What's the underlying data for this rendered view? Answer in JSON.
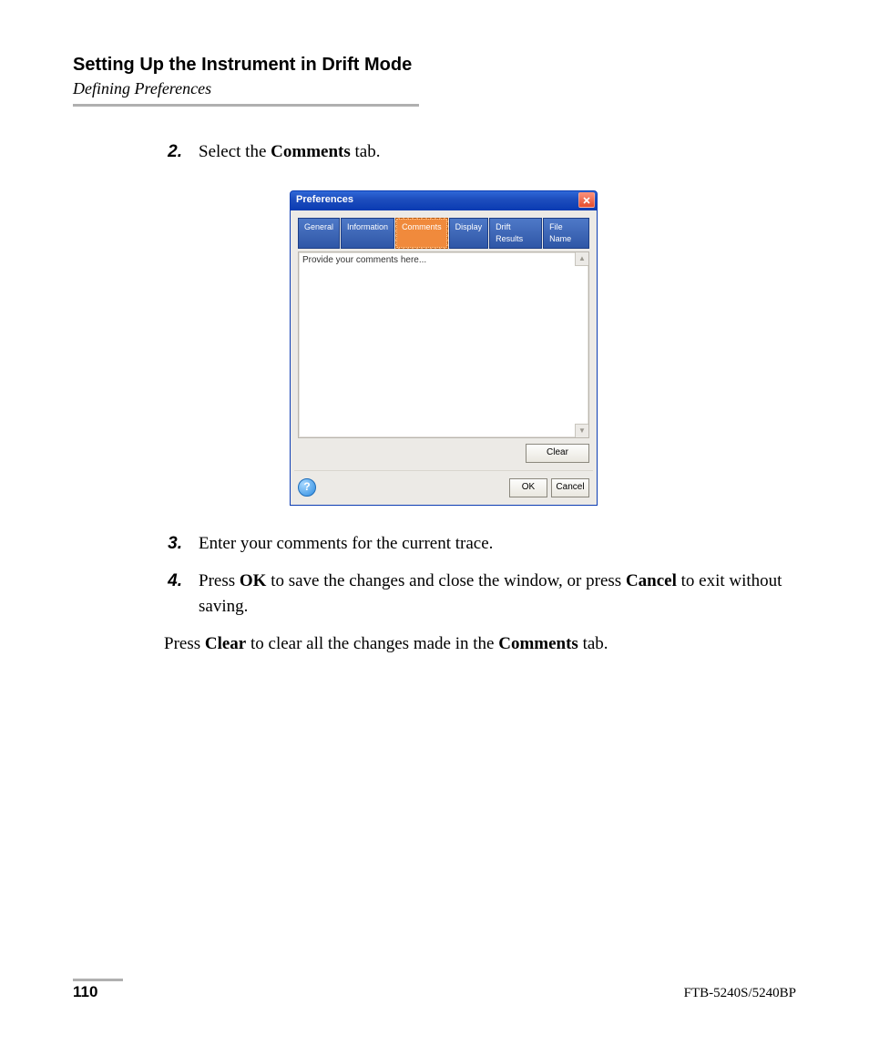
{
  "header": {
    "title": "Setting Up the Instrument in Drift Mode",
    "subtitle": "Defining Preferences"
  },
  "steps": {
    "s2": {
      "num": "2.",
      "pre": "Select the ",
      "bold": "Comments",
      "post": " tab."
    },
    "s3": {
      "num": "3.",
      "text": "Enter your comments for the current trace."
    },
    "s4": {
      "num": "4.",
      "pre": "Press ",
      "b1": "OK",
      "mid": " to save the changes and close the window, or press ",
      "b2": "Cancel",
      "post": " to exit without saving."
    }
  },
  "note": {
    "pre": "Press ",
    "b1": "Clear",
    "mid": " to clear all the changes made in the ",
    "b2": "Comments",
    "post": " tab."
  },
  "dialog": {
    "title": "Preferences",
    "tabs": {
      "general": "General",
      "information": "Information",
      "comments": "Comments",
      "display": "Display",
      "drift_results": "Drift Results",
      "file_name": "File Name"
    },
    "placeholder": "Provide your comments here...",
    "buttons": {
      "clear": "Clear",
      "ok": "OK",
      "cancel": "Cancel"
    },
    "help_glyph": "?",
    "scroll_up": "▲",
    "scroll_down": "▼"
  },
  "footer": {
    "page": "110",
    "docid": "FTB-5240S/5240BP"
  }
}
